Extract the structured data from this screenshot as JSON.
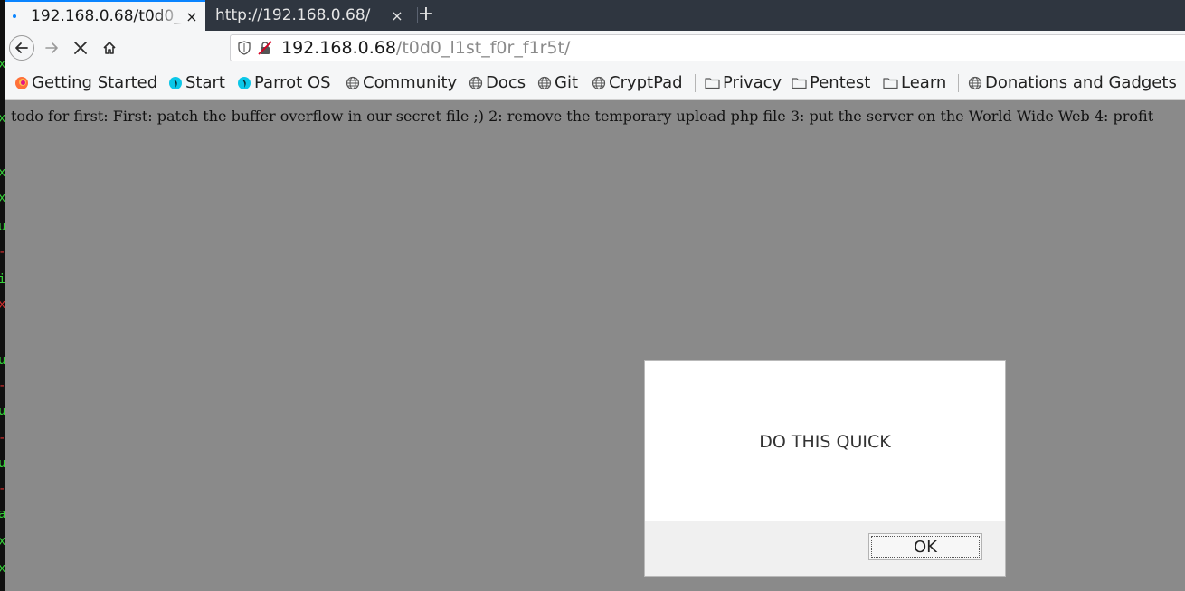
{
  "browser": {
    "tabs": [
      {
        "title": "192.168.0.68/t0d0_l1st_f0r_f1r5t/",
        "active": true,
        "close": "×"
      },
      {
        "title": "http://192.168.0.68/",
        "active": false,
        "close": "×"
      }
    ],
    "new_tab": "+",
    "nav": {
      "back_icon": "arrow-left-icon",
      "forward_icon": "arrow-right-icon",
      "stop_icon": "stop-x-icon",
      "home_icon": "home-icon"
    },
    "url": {
      "host": "192.168.0.68",
      "path": "/t0d0_l1st_f0r_f1r5t/",
      "shield_icon": "tracking-shield-icon",
      "insecure_icon": "insecure-lock-icon"
    },
    "bookmarks": [
      {
        "label": "Getting Started",
        "icon": "firefox-icon"
      },
      {
        "label": "Start",
        "icon": "parrot-icon"
      },
      {
        "label": "Parrot OS",
        "icon": "parrot-icon"
      },
      {
        "label": "Community",
        "icon": "globe-icon"
      },
      {
        "label": "Docs",
        "icon": "globe-icon"
      },
      {
        "label": "Git",
        "icon": "globe-icon"
      },
      {
        "label": "CryptPad",
        "icon": "globe-icon"
      },
      {
        "label": "Privacy",
        "icon": "folder-icon"
      },
      {
        "label": "Pentest",
        "icon": "folder-icon"
      },
      {
        "label": "Learn",
        "icon": "folder-icon"
      },
      {
        "label": "Donations and Gadgets",
        "icon": "globe-icon"
      }
    ]
  },
  "page": {
    "text": "todo for first: First: patch the buffer overflow in our secret file ;) 2: remove the temporary upload php file 3: put the server on the World Wide Web 4: profit"
  },
  "dialog": {
    "message": "DO THIS QUICK",
    "ok_label": "OK"
  },
  "colors": {
    "accent": "#0a84ff",
    "tabbar": "#2f3640",
    "overlay": "#8a8a8a"
  }
}
